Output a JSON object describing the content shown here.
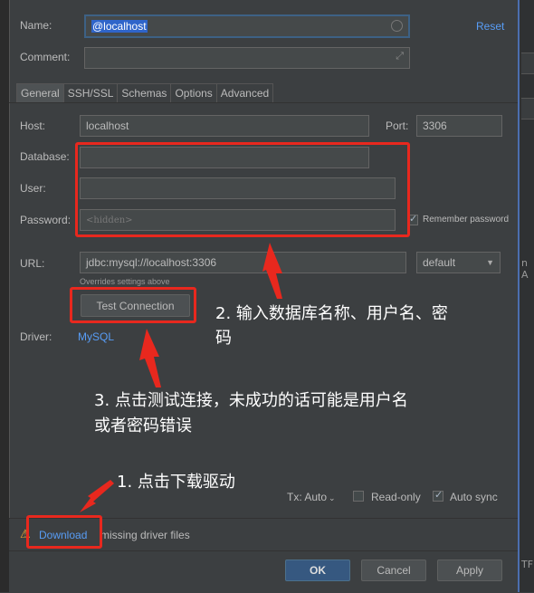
{
  "form": {
    "name_label": "Name:",
    "name_value": "@localhost",
    "reset_label": "Reset",
    "comment_label": "Comment:",
    "comment_value": ""
  },
  "tabs": [
    {
      "label": "General",
      "active": true
    },
    {
      "label": "SSH/SSL",
      "active": false
    },
    {
      "label": "Schemas",
      "active": false
    },
    {
      "label": "Options",
      "active": false
    },
    {
      "label": "Advanced",
      "active": false
    }
  ],
  "general": {
    "host_label": "Host:",
    "host_value": "localhost",
    "port_label": "Port:",
    "port_value": "3306",
    "database_label": "Database:",
    "database_value": "",
    "user_label": "User:",
    "user_value": "",
    "password_label": "Password:",
    "password_placeholder": "<hidden>",
    "remember_password_label": "Remember password",
    "remember_password_checked": true,
    "url_label": "URL:",
    "url_value": "jdbc:mysql://localhost:3306",
    "url_mode": "default",
    "url_hint": "Overrides settings above",
    "test_connection_label": "Test Connection",
    "driver_label": "Driver:",
    "driver_value": "MySQL"
  },
  "options_row": {
    "tx_label": "Tx: Auto",
    "readonly_label": "Read-only",
    "readonly_checked": false,
    "autosync_label": "Auto sync",
    "autosync_checked": true
  },
  "footer": {
    "download_label": "Download",
    "download_suffix": "missing driver files"
  },
  "buttons": {
    "ok": "OK",
    "cancel": "Cancel",
    "apply": "Apply"
  },
  "annotations": {
    "step1": "1. 点击下载驱动",
    "step2_line1": "2. 输入数据库名称、用户名、密",
    "step2_line2": "码",
    "step3_line1": "3. 点击测试连接，未成功的话可能是用户名",
    "step3_line2": "或者密码错误"
  },
  "right_edge_texts": [
    "n A",
    "TF"
  ],
  "colors": {
    "background": "#3c3f41",
    "accent_link": "#589df6",
    "annotation_red": "#e8281e",
    "primary_button": "#365880",
    "warning": "#f0a732"
  }
}
